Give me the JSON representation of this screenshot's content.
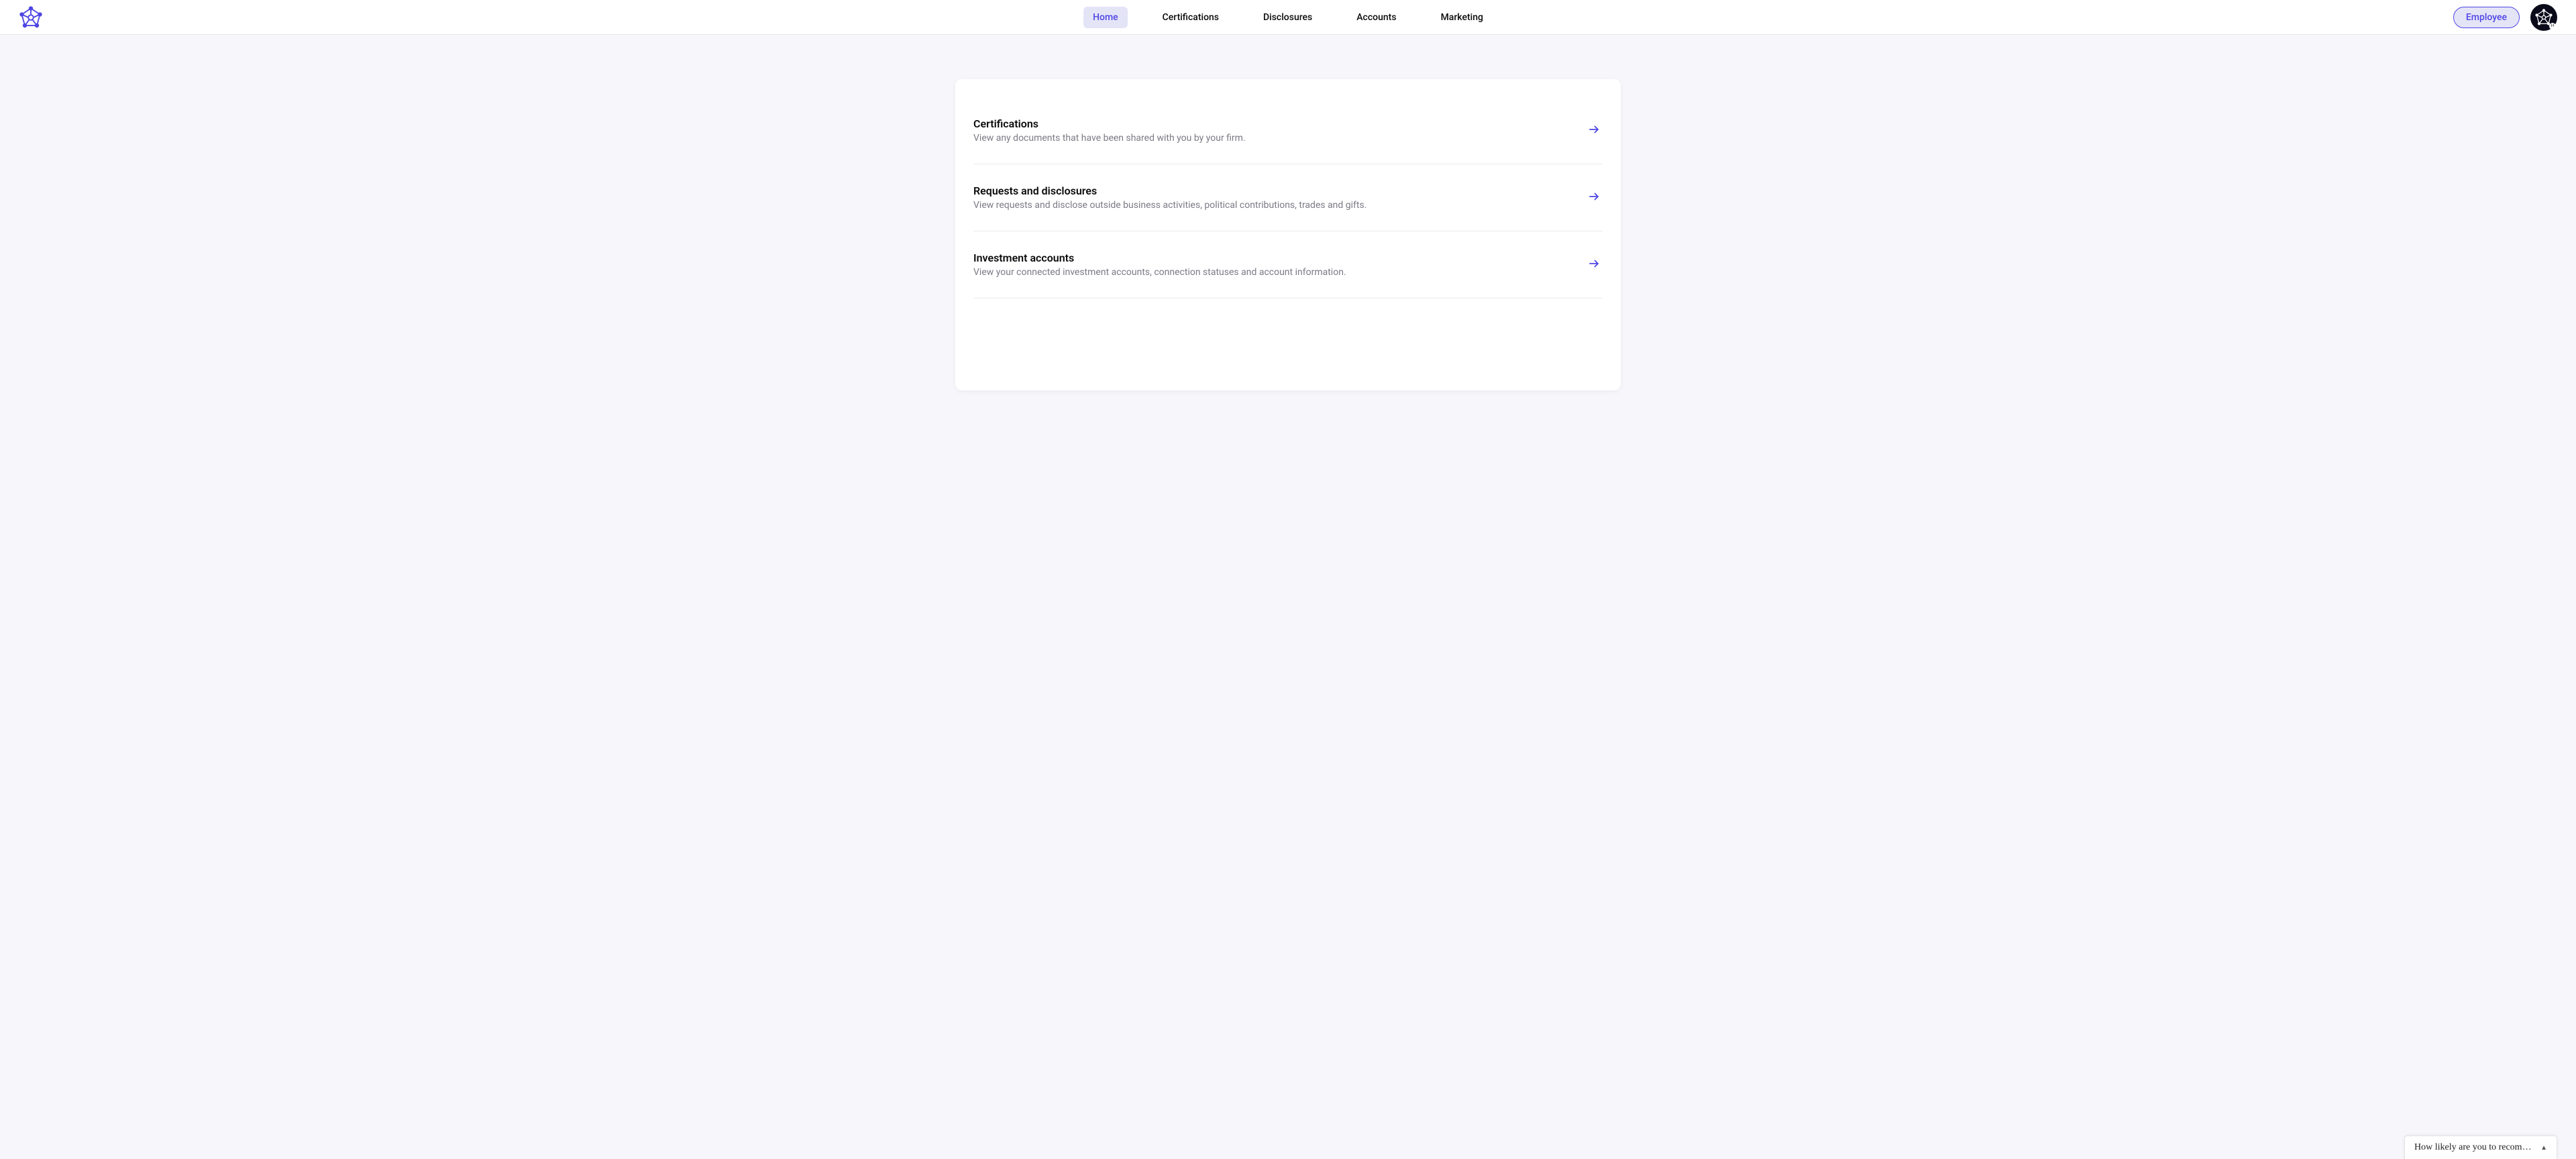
{
  "nav": {
    "items": [
      {
        "label": "Home",
        "active": true
      },
      {
        "label": "Certifications",
        "active": false
      },
      {
        "label": "Disclosures",
        "active": false
      },
      {
        "label": "Accounts",
        "active": false
      },
      {
        "label": "Marketing",
        "active": false
      }
    ]
  },
  "header": {
    "employee_label": "Employee"
  },
  "main": {
    "rows": [
      {
        "title": "Certifications",
        "description": "View any documents that have been shared with you by your firm."
      },
      {
        "title": "Requests and disclosures",
        "description": "View requests and disclose outside business activities, political contributions, trades and gifts."
      },
      {
        "title": "Investment accounts",
        "description": "View your connected investment accounts, connection statuses and account information."
      }
    ]
  },
  "feedback": {
    "prompt": "How likely are you to recommen…"
  }
}
